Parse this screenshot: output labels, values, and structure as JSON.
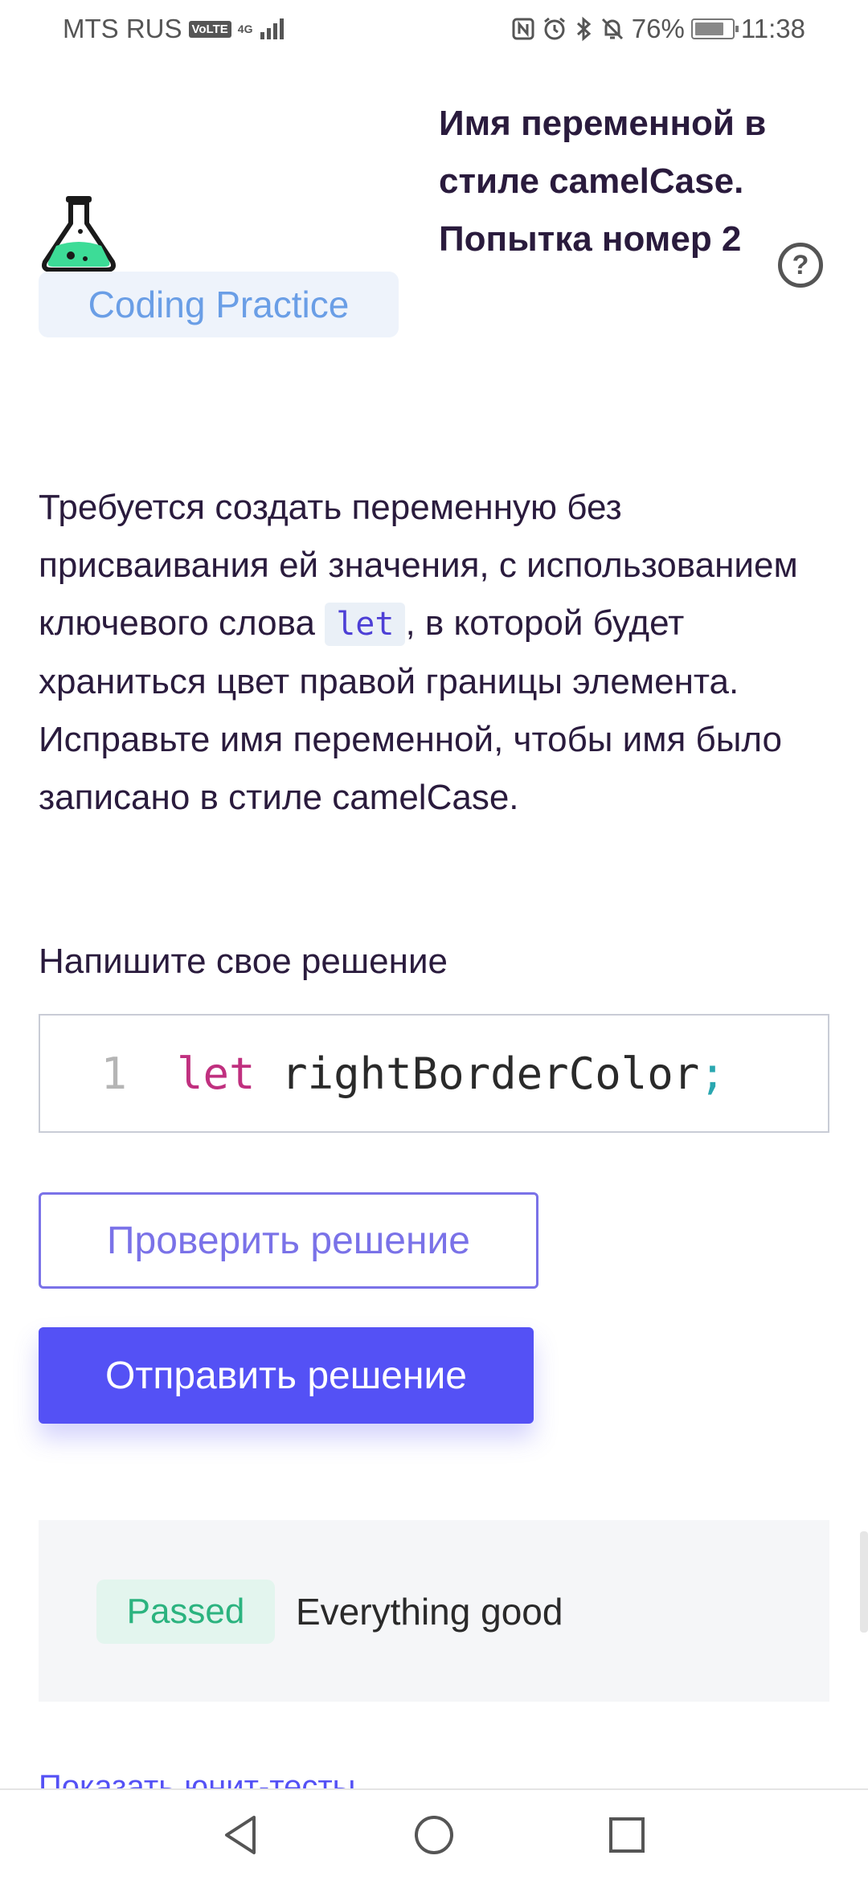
{
  "status_bar": {
    "carrier": "MTS RUS",
    "volte": "VoLTE",
    "network": "4G",
    "battery": "76%",
    "time": "11:38"
  },
  "header": {
    "badge": "Coding Practice",
    "title": "Имя переменной в стиле camelCase. Попытка номер 2",
    "help": "?"
  },
  "description": {
    "part1": "Требуется создать переменную без присваивания ей значения, с использованием ключевого слова",
    "keyword": "let",
    "part2": ", в которой будет храниться цвет правой границы элемента. Исправьте имя переменной, чтобы имя было записано в стиле camelCase."
  },
  "editor": {
    "label": "Напишите свое решение",
    "line_number": "1",
    "keyword": "let",
    "identifier": "rightBorderColor",
    "semicolon": ";"
  },
  "buttons": {
    "check": "Проверить решение",
    "submit": "Отправить решение"
  },
  "result": {
    "status": "Passed",
    "message": "Everything good"
  },
  "footer": {
    "show_tests": "Показать юнит-тесты"
  },
  "colors": {
    "accent": "#5451f5",
    "text": "#2a1b3d",
    "passed": "#2bb37f",
    "badge": "#6a9ee6"
  }
}
